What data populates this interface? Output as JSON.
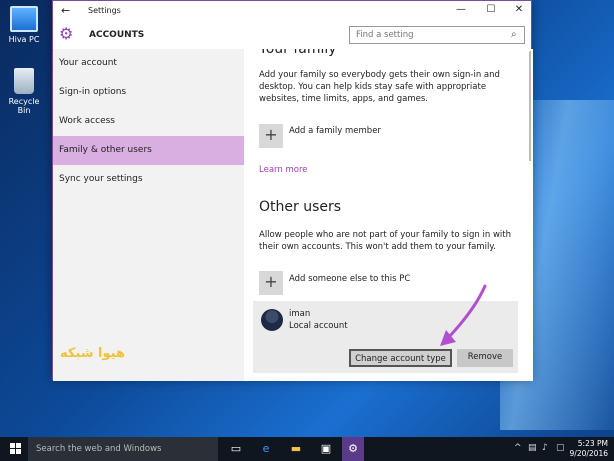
{
  "desktop": {
    "icons": [
      {
        "label": "Hiva PC",
        "icon": "computer-icon"
      },
      {
        "label": "Recycle Bin",
        "icon": "recycle-bin-icon"
      }
    ],
    "watermark": "هیوا شبکه"
  },
  "window": {
    "title": "Settings",
    "back": "←",
    "minimize": "—",
    "maximize": "☐",
    "close": "✕"
  },
  "header": {
    "section": "ACCOUNTS",
    "icon": "gear-icon",
    "search_placeholder": "Find a setting"
  },
  "sidebar": {
    "items": [
      {
        "label": "Your account",
        "active": false
      },
      {
        "label": "Sign-in options",
        "active": false
      },
      {
        "label": "Work access",
        "active": false
      },
      {
        "label": "Family & other users",
        "active": true
      },
      {
        "label": "Sync your settings",
        "active": false
      }
    ]
  },
  "content": {
    "family_heading": "Your family",
    "family_text": "Add your family so everybody gets their own sign-in and desktop. You can help kids stay safe with appropriate websites, time limits, apps, and games.",
    "add_family_member": "Add a family member",
    "learn_more": "Learn more",
    "other_heading": "Other users",
    "other_text": "Allow people who are not part of your family to sign in with their own accounts. This won't add them to your family.",
    "add_someone": "Add someone else to this PC",
    "user": {
      "name": "iman",
      "type": "Local account",
      "change_button": "Change account type",
      "remove_button": "Remove"
    }
  },
  "taskbar": {
    "search_placeholder": "Search the web and Windows",
    "time": "5:23 PM",
    "date": "9/20/2016",
    "accent": "#5c3a8a"
  }
}
